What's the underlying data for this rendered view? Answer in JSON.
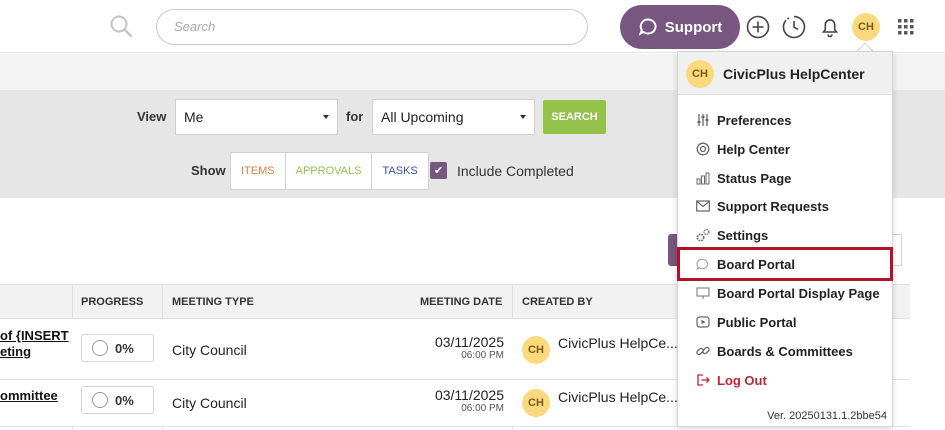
{
  "header": {
    "search_placeholder": "Search",
    "support_label": "Support",
    "avatar_initials": "CH"
  },
  "filters": {
    "view_label": "View",
    "view_value": "Me",
    "for_label": "for",
    "for_value": "All Upcoming",
    "search_button": "SEARCH",
    "show_label": "Show",
    "show_items": [
      {
        "label": "ITEMS",
        "color": "#e0813a"
      },
      {
        "label": "APPROVALS",
        "color": "#94c24a"
      },
      {
        "label": "TASKS",
        "color": "#3b4fa0"
      }
    ],
    "include_completed": "Include Completed"
  },
  "table": {
    "headers": [
      "PROGRESS",
      "MEETING TYPE",
      "MEETING DATE",
      "CREATED BY"
    ],
    "rows": [
      {
        "name_line1": "of {INSERT",
        "name_line2": "eting",
        "progress": "0%",
        "meeting_type": "City Council",
        "date": "03/11/2025",
        "time": "06:00 PM",
        "avatar": "CH",
        "created_by": "CivicPlus HelpCe..."
      },
      {
        "name_line1": "ommittee",
        "progress": "0%",
        "meeting_type": "City Council",
        "date": "03/11/2025",
        "time": "06:00 PM",
        "avatar": "CH",
        "created_by": "CivicPlus HelpCe..."
      }
    ]
  },
  "menu": {
    "avatar_initials": "CH",
    "user_name": "CivicPlus HelpCenter",
    "items": [
      {
        "label": "Preferences",
        "icon": "sliders-icon"
      },
      {
        "label": "Help Center",
        "icon": "lifebuoy-icon"
      },
      {
        "label": "Status Page",
        "icon": "status-chart-icon"
      },
      {
        "label": "Support Requests",
        "icon": "envelope-icon"
      },
      {
        "label": "Settings",
        "icon": "gears-icon"
      },
      {
        "label": "Board Portal",
        "icon": "chat-bubble-icon"
      },
      {
        "label": "Board Portal Display Page",
        "icon": "monitor-icon"
      },
      {
        "label": "Public Portal",
        "icon": "play-icon"
      },
      {
        "label": "Boards & Committees",
        "icon": "link-icon"
      },
      {
        "label": "Log Out",
        "icon": "logout-icon"
      }
    ],
    "version": "Ver. 20250131.1.2bbe54"
  },
  "colors": {
    "brand_purple": "#77567f",
    "search_green": "#94c24a",
    "highlight_red": "#b3132a",
    "avatar_yellow": "#fbd97f"
  }
}
